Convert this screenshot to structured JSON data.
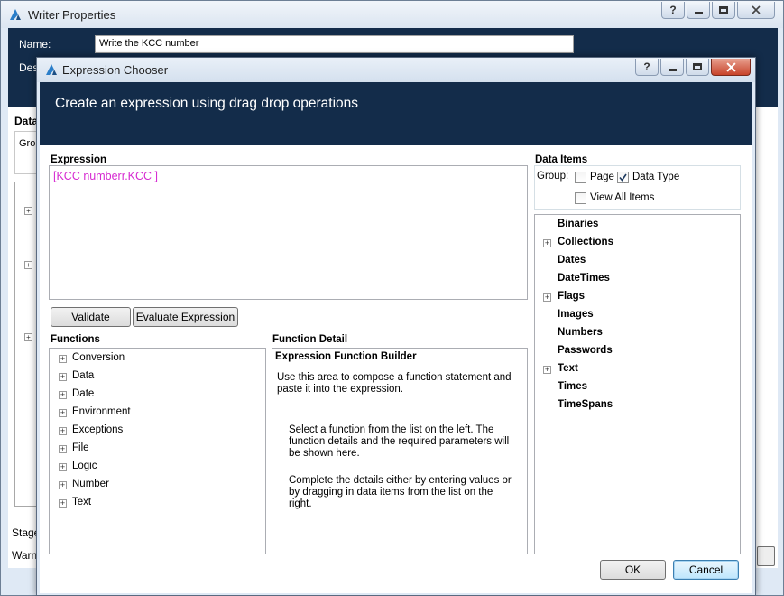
{
  "writer_window": {
    "title": "Writer Properties",
    "name_label": "Name:",
    "name_value": "Write the KCC number",
    "description_label": "Des",
    "data_label": "Data",
    "group_label": "Gro",
    "stage_label": "Stage",
    "warning_label": "Warn"
  },
  "dialog": {
    "title": "Expression Chooser",
    "header": "Create an expression using drag drop operations",
    "help_glyph": "?",
    "expression": {
      "label": "Expression",
      "value": "[KCC numberr.KCC ]"
    },
    "buttons": {
      "validate": "Validate",
      "evaluate": "Evaluate Expression",
      "ok": "OK",
      "cancel": "Cancel"
    },
    "functions": {
      "label": "Functions",
      "items": [
        "Conversion",
        "Data",
        "Date",
        "Environment",
        "Exceptions",
        "File",
        "Logic",
        "Number",
        "Text"
      ]
    },
    "function_detail": {
      "label": "Function Detail",
      "title": "Expression Function Builder",
      "para1": "Use this area to compose a function statement and paste it into the expression.",
      "para2": "Select a function from the list on the left. The function details and the required parameters will be shown here.",
      "para3": "Complete the details either by entering values or by dragging in data items from the list on the right."
    },
    "data_items": {
      "label": "Data Items",
      "group_label": "Group:",
      "page_label": "Page",
      "page_checked": false,
      "data_type_label": "Data Type",
      "data_type_checked": true,
      "view_all_label": "View All Items",
      "view_all_checked": false,
      "items": [
        {
          "label": "Binaries",
          "expandable": false
        },
        {
          "label": "Collections",
          "expandable": true
        },
        {
          "label": "Dates",
          "expandable": false
        },
        {
          "label": "DateTimes",
          "expandable": false
        },
        {
          "label": "Flags",
          "expandable": true
        },
        {
          "label": "Images",
          "expandable": false
        },
        {
          "label": "Numbers",
          "expandable": false
        },
        {
          "label": "Passwords",
          "expandable": false
        },
        {
          "label": "Text",
          "expandable": true
        },
        {
          "label": "Times",
          "expandable": false
        },
        {
          "label": "TimeSpans",
          "expandable": false
        }
      ]
    }
  },
  "icons": {
    "app": "blueprism-logo-icon",
    "help": "help-icon",
    "minimize": "minimize-icon",
    "maximize": "maximize-icon",
    "close": "close-icon",
    "expand": "plus-expander-icon",
    "check": "checkmark-icon"
  },
  "colors": {
    "header_bg": "#132c4a",
    "expression_text": "#d62ad1",
    "window_bg": "#dfe9f5"
  }
}
